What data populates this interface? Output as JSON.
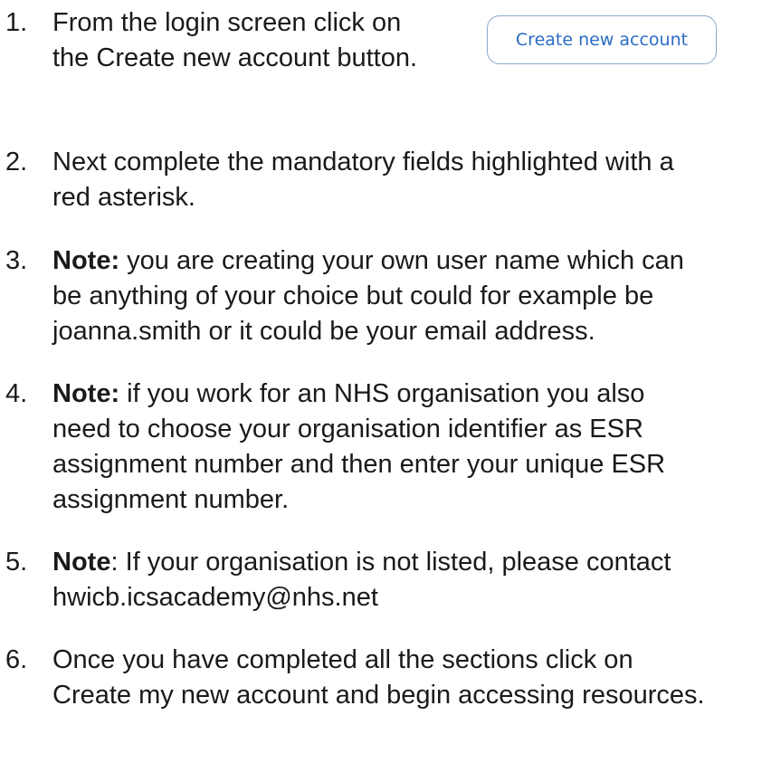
{
  "steps": [
    {
      "number": "1.",
      "lines": [
        "From the login screen click on",
        "the Create new account button."
      ]
    },
    {
      "number": "2.",
      "lines": [
        "Next complete the mandatory fields highlighted with a",
        "red asterisk."
      ]
    },
    {
      "number": "3.",
      "note_label": "Note:",
      "lines": [
        " you are creating your own user name which can",
        "be anything of your choice but could for example be",
        "joanna.smith or it could be your email address."
      ]
    },
    {
      "number": "4.",
      "note_label": "Note:",
      "lines": [
        " if you work for an NHS organisation you also",
        "need to choose your organisation identifier as ESR",
        "assignment number and then enter your unique ESR",
        "assignment number."
      ]
    },
    {
      "number": "5.",
      "note_label": "Note",
      "lines": [
        ": If your organisation is not listed, please contact",
        "hwicb.icsacademy@nhs.net"
      ]
    },
    {
      "number": "6.",
      "lines": [
        "Once you have completed all the sections click on",
        "Create my new account and begin accessing resources."
      ]
    }
  ],
  "create_button": {
    "label": "Create new account",
    "border_color": "#8aa9cf",
    "text_color": "#2b6cc4"
  }
}
